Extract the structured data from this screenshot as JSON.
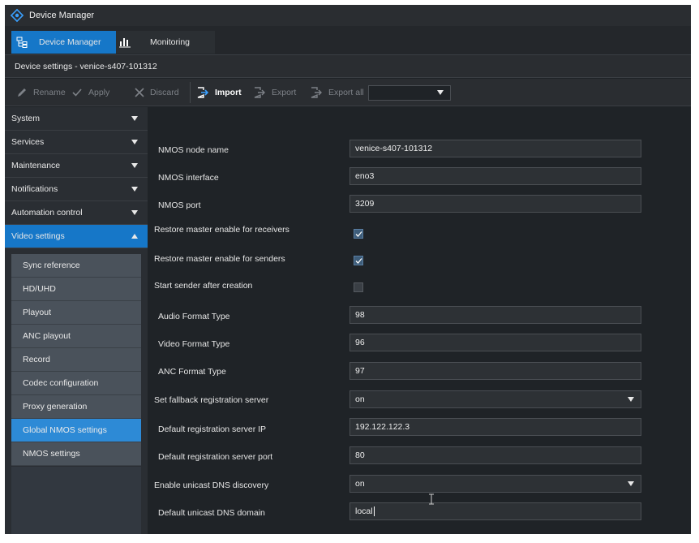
{
  "app": {
    "title": "Device Manager"
  },
  "tabs": [
    {
      "label": "Device Manager",
      "active": true
    },
    {
      "label": "Monitoring",
      "active": false
    }
  ],
  "subtitle": "Device settings - venice-s407-101312",
  "toolbar": {
    "rename": "Rename",
    "apply": "Apply",
    "discard": "Discard",
    "import": "Import",
    "export": "Export",
    "export_all": "Export all",
    "select_value": ""
  },
  "sidebar": {
    "sections": [
      {
        "label": "System",
        "expanded": false
      },
      {
        "label": "Services",
        "expanded": false
      },
      {
        "label": "Maintenance",
        "expanded": false
      },
      {
        "label": "Notifications",
        "expanded": false
      },
      {
        "label": "Automation control",
        "expanded": false
      },
      {
        "label": "Video settings",
        "expanded": true
      }
    ],
    "video_items": [
      {
        "label": "Sync reference"
      },
      {
        "label": "HD/UHD"
      },
      {
        "label": "Playout"
      },
      {
        "label": "ANC playout"
      },
      {
        "label": "Record"
      },
      {
        "label": "Codec configuration"
      },
      {
        "label": "Proxy generation"
      },
      {
        "label": "Global NMOS settings",
        "selected": true
      },
      {
        "label": "NMOS settings"
      }
    ]
  },
  "form": {
    "nmos_node_name": {
      "label": "NMOS node name",
      "value": "venice-s407-101312"
    },
    "nmos_interface": {
      "label": "NMOS interface",
      "value": "eno3"
    },
    "nmos_port": {
      "label": "NMOS port",
      "value": "3209"
    },
    "restore_receivers": {
      "label": "Restore master enable for receivers",
      "checked": true
    },
    "restore_senders": {
      "label": "Restore master enable for senders",
      "checked": true
    },
    "start_sender": {
      "label": "Start sender after creation",
      "checked": false
    },
    "audio_format": {
      "label": "Audio Format Type",
      "value": "98"
    },
    "video_format": {
      "label": "Video Format Type",
      "value": "96"
    },
    "anc_format": {
      "label": "ANC Format Type",
      "value": "97"
    },
    "fallback_server": {
      "label": "Set fallback registration server",
      "value": "on"
    },
    "default_server_ip": {
      "label": "Default registration server IP",
      "value": "192.122.122.3"
    },
    "default_server_port": {
      "label": "Default registration server port",
      "value": "80"
    },
    "unicast_dns": {
      "label": "Enable unicast DNS discovery",
      "value": "on"
    },
    "unicast_dns_domain": {
      "label": "Default unicast DNS domain",
      "value": "local"
    }
  },
  "colors": {
    "accent": "#1677c8",
    "selected_item": "#2d8ad6",
    "background": "#1f2327",
    "panel": "#2a2e33"
  },
  "icons": {
    "logo": "device-manager-logo-icon",
    "device_manager_tab": "device-tree-icon",
    "monitoring_tab": "bar-chart-icon",
    "rename": "pencil-icon",
    "apply": "check-icon",
    "discard": "x-icon",
    "import": "import-icon",
    "export": "export-icon",
    "export_all": "export-all-icon"
  }
}
